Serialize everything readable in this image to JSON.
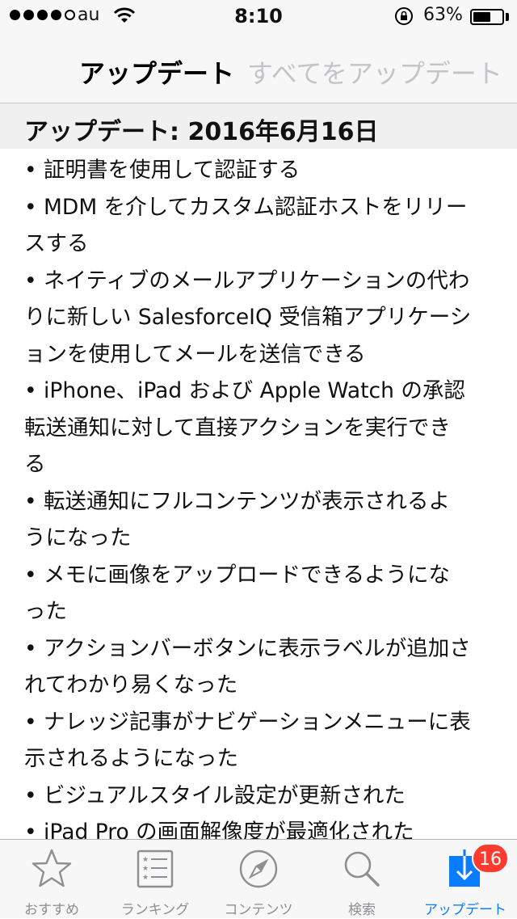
{
  "status_bar": {
    "carrier": "au",
    "time": "8:10",
    "battery_percent": "63%",
    "battery_level": 0.63,
    "signal_bars_filled": 4,
    "signal_bars_total": 5
  },
  "nav": {
    "title": "アップデート",
    "update_all_label": "すべてをアップデート"
  },
  "section": {
    "header": "アップデート: 2016年6月16日"
  },
  "release_notes": [
    "• 証明書を使用して認証する",
    "• MDM を介してカスタム認証ホストをリリー",
    "スする",
    "• ネイティブのメールアプリケーションの代わ",
    "りに新しい SalesforceIQ 受信箱アプリケーシ",
    "ョンを使用してメールを送信できる",
    "• iPhone、iPad および Apple Watch の承認",
    "転送通知に対して直接アクションを実行でき",
    "る",
    "• 転送通知にフルコンテンツが表示されるよ",
    "うになった",
    "• メモに画像をアップロードできるようにな",
    "った",
    "• アクションバーボタンに表示ラベルが追加さ",
    "れてわかり易くなった",
    "• ナレッジ記事がナビゲーションメニューに表",
    "示されるようになった",
    "• ビジュアルスタイル設定が更新された",
    "• iPad Pro の画面解像度が最適化された"
  ],
  "tabs": [
    {
      "label": "おすすめ",
      "icon": "star-icon",
      "active": false
    },
    {
      "label": "ランキング",
      "icon": "ranking-list-icon",
      "active": false
    },
    {
      "label": "コンテンツ",
      "icon": "compass-icon",
      "active": false
    },
    {
      "label": "検索",
      "icon": "search-icon",
      "active": false
    },
    {
      "label": "アップデート",
      "icon": "download-icon",
      "active": true
    }
  ],
  "updates_badge": "16",
  "colors": {
    "accent": "#0a7cff",
    "badge": "#ff3b30",
    "inactive": "#8e8e93",
    "disabled_action": "#c4c4c8"
  }
}
